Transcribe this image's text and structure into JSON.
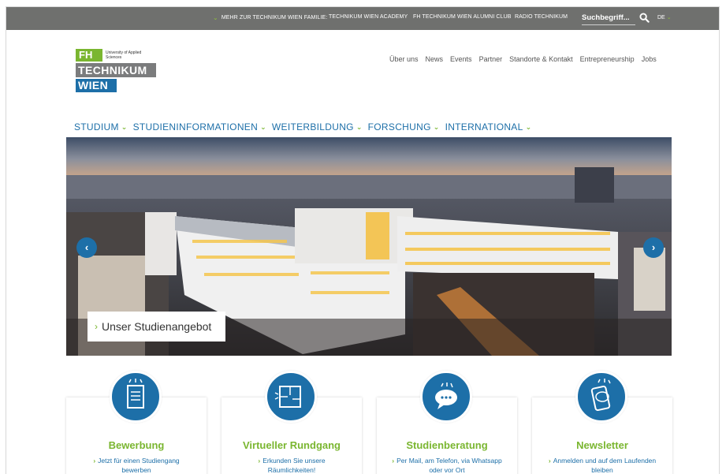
{
  "topbar": {
    "family_label": "MEHR ZUR TECHNIKUM WIEN FAMILIE:",
    "links": [
      "TECHNIKUM WIEN ACADEMY",
      "FH TECHNIKUM WIEN ALUMNI CLUB",
      "RADIO TECHNIKUM"
    ],
    "search_placeholder": "Suchbegriff...",
    "language": "DE",
    "background": "#6f706e"
  },
  "logo": {
    "fh": "FH",
    "university": "University of Applied Sciences",
    "technikum": "TECHNIKUM",
    "wien": "WIEN"
  },
  "topnav": [
    "Über uns",
    "News",
    "Events",
    "Partner",
    "Standorte & Kontakt",
    "Entrepreneurship",
    "Jobs"
  ],
  "mainnav": [
    "STUDIUM",
    "STUDIENINFORMATIONEN",
    "WEITERBILDUNG",
    "FORSCHUNG",
    "INTERNATIONAL"
  ],
  "hero": {
    "caption": "Unser Studienangebot",
    "prev_icon": "chevron-left-icon",
    "next_icon": "chevron-right-icon"
  },
  "cards": [
    {
      "title": "Bewerbung",
      "text": "Jetzt für einen Studiengang bewerben",
      "icon": "document-icon"
    },
    {
      "title": "Virtueller Rundgang",
      "text": "Erkunden Sie unsere Räumlichkeiten!",
      "icon": "floorplan-icon"
    },
    {
      "title": "Studienberatung",
      "text": "Per Mail, am Telefon, via Whatsapp oder vor Ort",
      "icon": "chat-bubble-icon"
    },
    {
      "title": "Newsletter",
      "text": "Anmelden und auf dem Laufenden bleiben",
      "icon": "smartphone-icon"
    }
  ],
  "colors": {
    "brand_blue": "#1d6fa8",
    "brand_green": "#7ab630",
    "topbar_gray": "#6f706e"
  }
}
